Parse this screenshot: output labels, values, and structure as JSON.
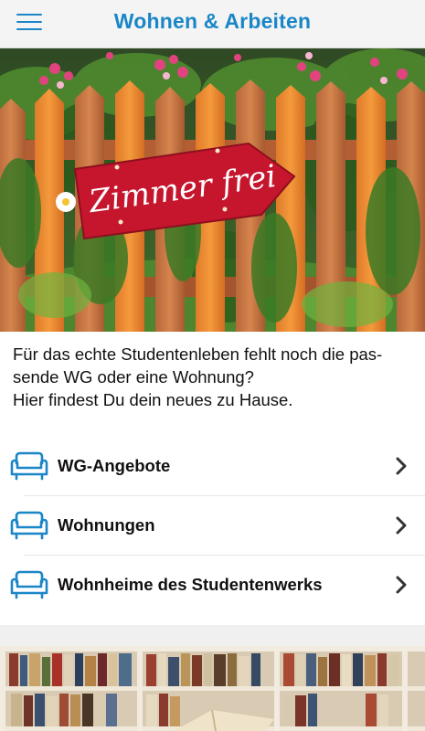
{
  "header": {
    "title": "Wohnen & Arbeiten",
    "menu_icon": "hamburger-menu-icon",
    "accent_color": "#1a86c7"
  },
  "hero": {
    "sign_text": "Zimmer frei"
  },
  "intro": {
    "line1": "Für das echte Studentenleben fehlt noch die pas-",
    "line2": "sende WG oder eine Wohnung?",
    "line3": "Hier findest Du dein neues zu Hause."
  },
  "list": {
    "items": [
      {
        "label": "WG-Angebote",
        "icon": "sofa-icon"
      },
      {
        "label": "Wohnungen",
        "icon": "sofa-icon"
      },
      {
        "label": "Wohnheime des Studentenwerks",
        "icon": "sofa-icon"
      }
    ],
    "chevron_icon": "chevron-right-icon"
  }
}
